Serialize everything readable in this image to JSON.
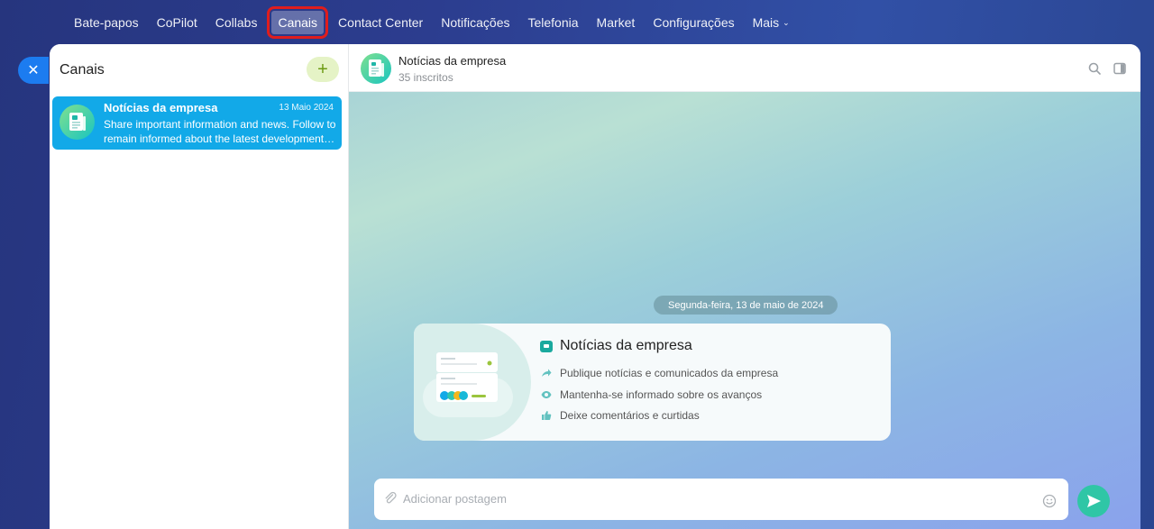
{
  "topnav": {
    "items": [
      {
        "label": "Bate-papos"
      },
      {
        "label": "CoPilot"
      },
      {
        "label": "Collabs"
      },
      {
        "label": "Canais",
        "active": true
      },
      {
        "label": "Contact Center"
      },
      {
        "label": "Notificações"
      },
      {
        "label": "Telefonia"
      },
      {
        "label": "Market"
      },
      {
        "label": "Configurações"
      },
      {
        "label": "Mais"
      }
    ]
  },
  "sidebar": {
    "title": "Canais",
    "add_label": "+",
    "channels": [
      {
        "name": "Notícias da empresa",
        "date": "13 Maio 2024",
        "preview_line1": "Share important information and news. Follow to",
        "preview_line2": "remain informed about the latest developments..."
      }
    ]
  },
  "chat": {
    "title": "Notícias da empresa",
    "subtitle": "35 inscritos",
    "date_separator": "Segunda-feira, 13 de maio de 2024",
    "welcome": {
      "title": "Notícias da empresa",
      "features": [
        {
          "icon": "share-arrow-icon",
          "text": "Publique notícias e comunicados da empresa"
        },
        {
          "icon": "eye-icon",
          "text": "Mantenha-se informado sobre os avanços"
        },
        {
          "icon": "thumbs-up-icon",
          "text": "Deixe comentários e curtidas"
        }
      ]
    },
    "composer": {
      "placeholder": "Adicionar postagem"
    }
  },
  "colors": {
    "accent_blue": "#12a9e8",
    "highlight_red": "#e01d1d",
    "send_green": "#2fc6a6",
    "add_green_bg": "#e5f3c6"
  }
}
